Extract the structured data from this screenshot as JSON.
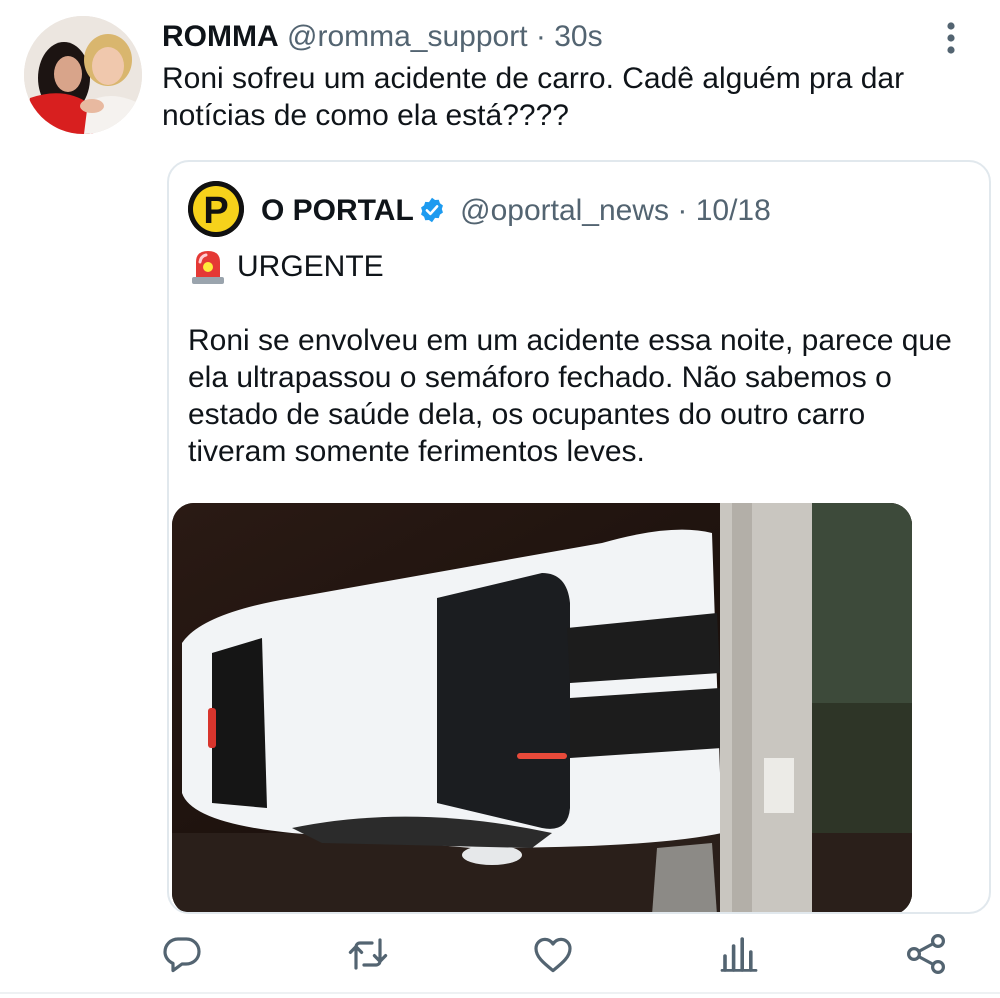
{
  "tweet": {
    "name": "ROMMA",
    "handle": "@romma_support",
    "separator": "·",
    "time": "30s",
    "text": "Roni sofreu um acidente de carro. Cadê alguém pra dar notícias de como ela está????"
  },
  "quoted": {
    "name": "O PORTAL",
    "handle": "@oportal_news",
    "separator": "·",
    "date": "10/18",
    "urgent_label": "URGENTE",
    "body": "Roni se envolveu em um acidente essa noite, parece que ela ultrapassou o semáforo fechado. Não sabemos o estado de saúde dela, os ocupantes do outro carro tiveram somente ferimentos leves.",
    "logo_letter": "P"
  },
  "icons": {
    "more": "more-vertical-icon",
    "verified": "verified-badge-icon",
    "siren": "siren-emoji-icon",
    "reply": "reply-icon",
    "retweet": "retweet-icon",
    "like": "heart-icon",
    "analytics": "analytics-icon",
    "share": "share-icon"
  },
  "colors": {
    "text": "#0f1419",
    "secondary": "#536471",
    "verified": "#1d9bf0",
    "border": "#e1e8ed",
    "logo_yellow": "#f6d21b"
  }
}
